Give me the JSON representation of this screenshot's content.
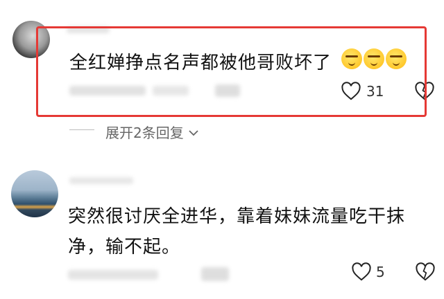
{
  "comments": [
    {
      "text": "全红婵挣点名声都被他哥败坏了",
      "emoji_icons": [
        "grimace-emoji",
        "grimace-emoji",
        "grimace-emoji"
      ],
      "like_count": "31",
      "highlighted": true,
      "highlight_color": "#e53935"
    },
    {
      "text_line1": "突然很讨厌全进华，靠着妹妹流量吃干抹",
      "text_line2": "净，输不起。",
      "like_count": "5"
    }
  ],
  "replies": {
    "expand_label": "展开2条回复"
  },
  "icons": {
    "like": "heart-icon",
    "dislike": "broken-heart-icon",
    "expand": "chevron-down-icon"
  }
}
